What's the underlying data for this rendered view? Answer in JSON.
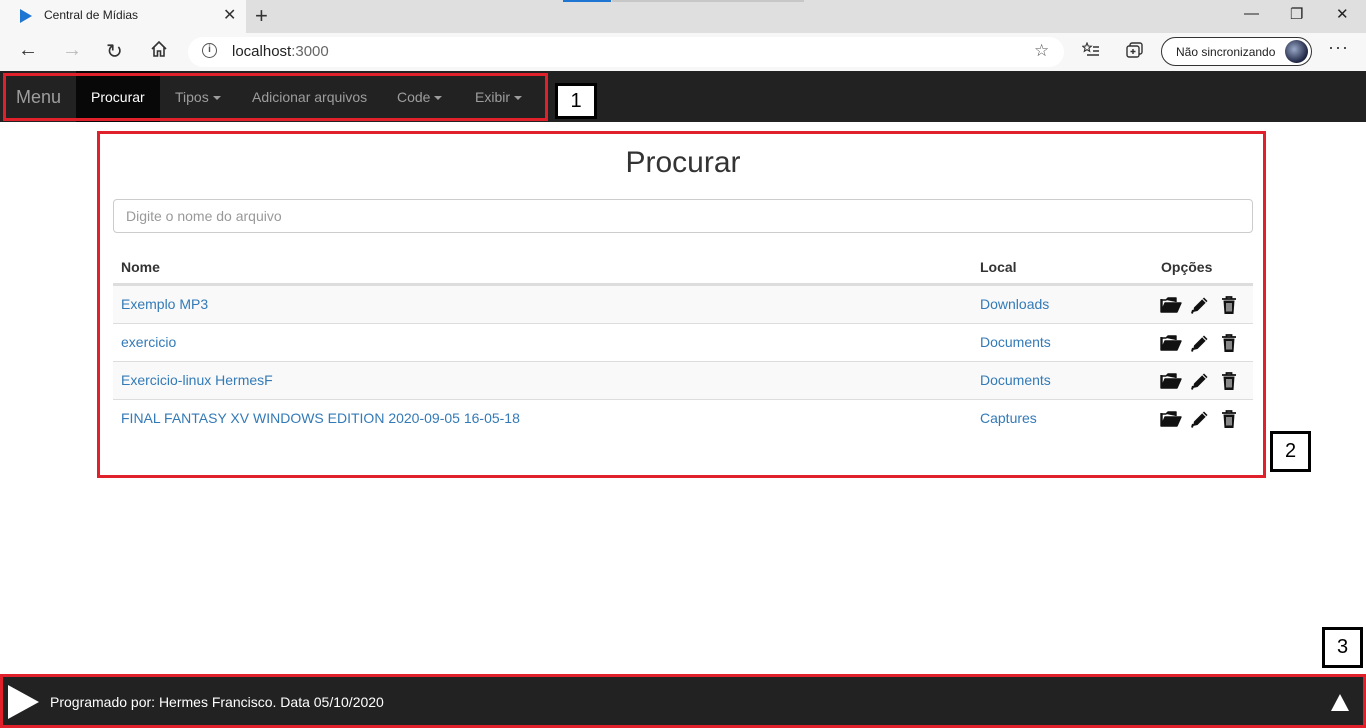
{
  "browser": {
    "tab_title": "Central de Mídias",
    "url_host": "localhost",
    "url_port": ":3000",
    "sync_label": "Não sincronizando",
    "accent_color": "#1f76d2"
  },
  "navbar": {
    "brand": "Menu",
    "items": [
      {
        "label": "Procurar",
        "active": true,
        "dropdown": false
      },
      {
        "label": "Tipos",
        "active": false,
        "dropdown": true
      },
      {
        "label": "Adicionar arquivos",
        "active": false,
        "dropdown": false
      },
      {
        "label": "Code",
        "active": false,
        "dropdown": true
      },
      {
        "label": "Exibir",
        "active": false,
        "dropdown": true
      }
    ]
  },
  "annotations": {
    "n1": "1",
    "n2": "2",
    "n3": "3",
    "highlight_color": "#e0202a"
  },
  "main": {
    "title": "Procurar",
    "search_placeholder": "Digite o nome do arquivo",
    "columns": {
      "name": "Nome",
      "location": "Local",
      "options": "Opções"
    },
    "rows": [
      {
        "name": "Exemplo MP3",
        "location": "Downloads"
      },
      {
        "name": "exercicio",
        "location": "Documents"
      },
      {
        "name": "Exercicio-linux HermesF",
        "location": "Documents"
      },
      {
        "name": "FINAL FANTASY XV WINDOWS EDITION 2020-09-05 16-05-18",
        "location": "Captures"
      }
    ],
    "row_icons": [
      "folder-open-icon",
      "pencil-icon",
      "trash-icon"
    ]
  },
  "footer": {
    "text": "Programado por: Hermes Francisco. Data 05/10/2020"
  }
}
